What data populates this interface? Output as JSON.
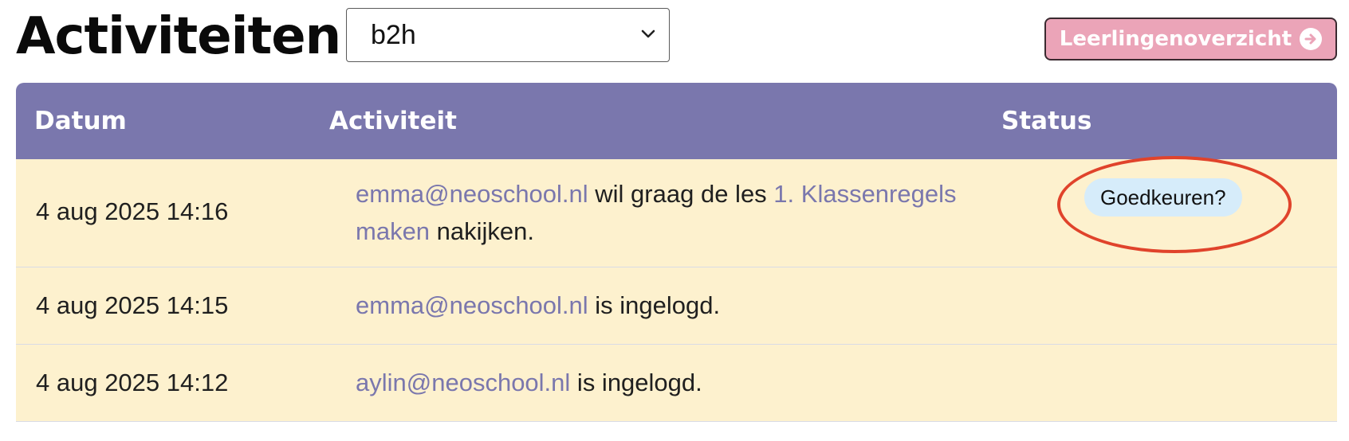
{
  "header": {
    "title": "Activiteiten",
    "class_select": {
      "value": "b2h"
    },
    "overview_button": {
      "label": "Leerlingenoverzicht",
      "icon": "arrow-circle-right-icon"
    }
  },
  "table": {
    "columns": [
      "Datum",
      "Activiteit",
      "Status"
    ],
    "rows": [
      {
        "date": "4 aug 2025 14:16",
        "user": "emma@neoschool.nl",
        "text_1": " wil graag de les ",
        "lesson": "1. Klassenregels maken",
        "text_2": " nakijken.",
        "status": "Goedkeuren?"
      },
      {
        "date": "4 aug 2025 14:15",
        "user": "emma@neoschool.nl",
        "text_1": " is ingelogd."
      },
      {
        "date": "4 aug 2025 14:12",
        "user": "aylin@neoschool.nl",
        "text_1": " is ingelogd."
      }
    ]
  },
  "colors": {
    "header_bg": "#7a77ad",
    "row_bg": "#fdf1ce",
    "button_bg": "#eba4b8",
    "link": "#7a77ad",
    "badge_bg": "#d6ecfa",
    "highlight": "#e0432b"
  }
}
